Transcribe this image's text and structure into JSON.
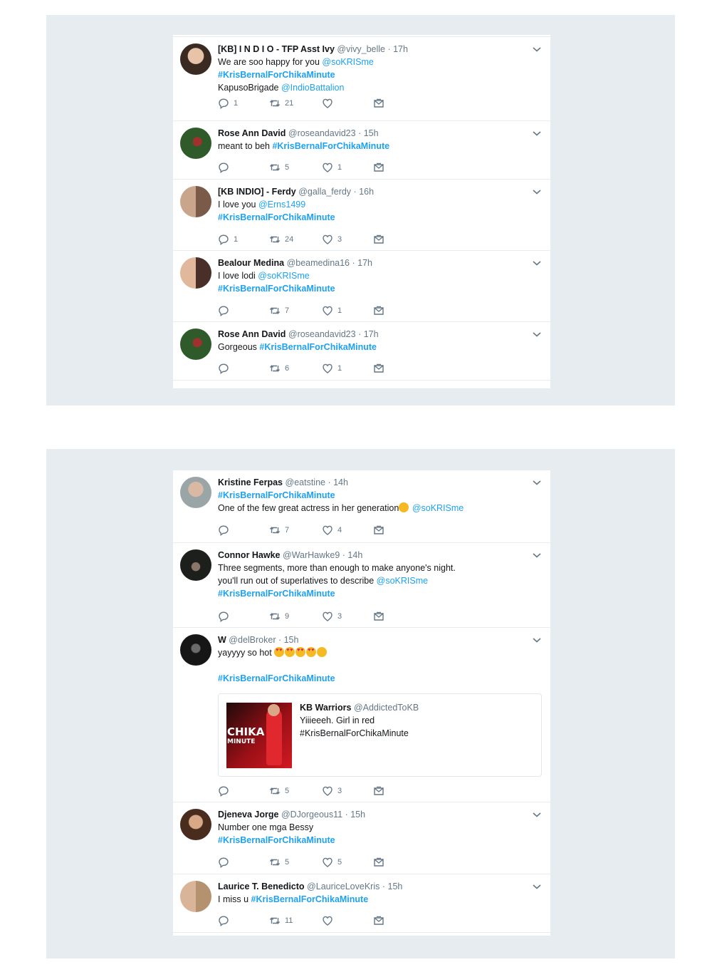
{
  "panel1": {
    "tweets": [
      {
        "name": "[KB] I N D I O - TFP Asst Ivy",
        "handle": "@vivy_belle",
        "time": "· 17h",
        "line1_text": "We are soo happy for you ",
        "line1_link": "@soKRISme",
        "line2_hash": "#KrisBernalForChikaMinute",
        "line3_text": "KapusoBrigade ",
        "line3_link": "@IndioBattalion",
        "replies": "1",
        "retweets": "21",
        "likes": ""
      },
      {
        "name": "Rose Ann David",
        "handle": "@roseandavid23",
        "time": "· 15h",
        "line1_text": "meant to beh ",
        "line1_hash": "#KrisBernalForChikaMinute",
        "replies": "",
        "retweets": "5",
        "likes": "1"
      },
      {
        "name": "[KB INDIO] - Ferdy",
        "handle": "@galla_ferdy",
        "time": "· 16h",
        "line1_text": "I love you ",
        "line1_link": "@Erns1499",
        "line2_hash": "#KrisBernalForChikaMinute",
        "replies": "1",
        "retweets": "24",
        "likes": "3"
      },
      {
        "name": "Bealour Medina",
        "handle": "@beamedina16",
        "time": "· 17h",
        "line1_text": "I love lodi ",
        "line1_link": "@soKRISme",
        "line2_hash": "#KrisBernalForChikaMinute",
        "replies": "",
        "retweets": "7",
        "likes": "1"
      },
      {
        "name": "Rose Ann David",
        "handle": "@roseandavid23",
        "time": "· 17h",
        "line1_text": "Gorgeous ",
        "line1_hash": "#KrisBernalForChikaMinute",
        "replies": "",
        "retweets": "6",
        "likes": "1"
      }
    ]
  },
  "panel2": {
    "tweets": [
      {
        "name": "Kristine Ferpas",
        "handle": "@eatstine",
        "time": "· 14h",
        "line1_hash": "#KrisBernalForChikaMinute",
        "line2_text": "One of the few great actress in her generation",
        "line2_link": "@soKRISme",
        "replies": "",
        "retweets": "7",
        "likes": "4"
      },
      {
        "name": "Connor Hawke",
        "handle": "@WarHawke9",
        "time": "· 14h",
        "line1_text": "Three segments, more than enough to make anyone's night.",
        "line2_text": "you'll run out of superlatives to describe ",
        "line2_link": "@soKRISme",
        "line3_hash": "#KrisBernalForChikaMinute",
        "replies": "",
        "retweets": "9",
        "likes": "3"
      },
      {
        "name": "W",
        "handle": "@delBroker",
        "time": "· 15h",
        "line1_text": "yayyyy so hot ",
        "line2_hash": "#KrisBernalForChikaMinute",
        "quote": {
          "name": "KB Warriors",
          "handle": "@AddictedToKB",
          "line1": "Yiiieeeh. Girl in red",
          "line2": "#KrisBernalForChikaMinute",
          "image_text1": "CHIKA",
          "image_text2": "MINUTE"
        },
        "replies": "",
        "retweets": "5",
        "likes": "3"
      },
      {
        "name": "Djeneva Jorge",
        "handle": "@DJorgeous11",
        "time": "· 15h",
        "line1_text": "Number one mga Bessy",
        "line2_hash": "#KrisBernalForChikaMinute",
        "replies": "",
        "retweets": "5",
        "likes": "5"
      },
      {
        "name": "Laurice T. Benedicto",
        "handle": "@LauriceLoveKris",
        "time": "· 15h",
        "line1_text": "I miss u ",
        "line1_hash": "#KrisBernalForChikaMinute",
        "replies": "",
        "retweets": "11",
        "likes": ""
      }
    ]
  },
  "icons": [
    "reply-icon",
    "retweet-icon",
    "like-icon",
    "direct-message-icon",
    "chevron-down-icon"
  ],
  "colors": {
    "background_panel": "#e6ecf0",
    "link": "#1da1f2",
    "meta": "#657786",
    "text": "#14171a"
  }
}
